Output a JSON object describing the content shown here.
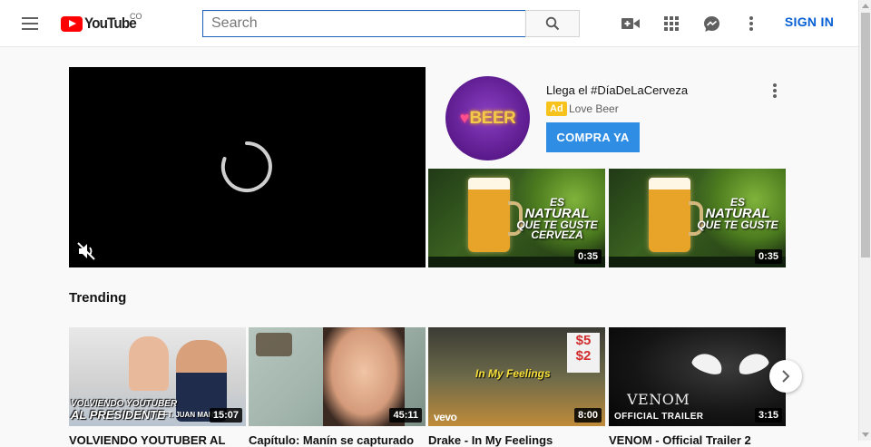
{
  "header": {
    "logo_text": "YouTube",
    "country_code": "CO",
    "search_placeholder": "Search",
    "sign_in_label": "SIGN IN"
  },
  "ad": {
    "title": "Llega el #DíaDeLaCerveza",
    "badge": "Ad",
    "channel": "Love Beer",
    "cta_label": "COMPRA YA",
    "avatar_brand": "BEER",
    "thumbnails": [
      {
        "line1": "ES",
        "line2": "NATURAL",
        "line3": "QUE TE GUSTE",
        "line4": "CERVEZA",
        "duration": "0:35"
      },
      {
        "line1": "ES",
        "line2": "NATURAL",
        "line3": "QUE TE GUSTE",
        "line4": "",
        "duration": "0:35"
      }
    ]
  },
  "trending": {
    "title": "Trending",
    "videos": [
      {
        "title": "VOLVIENDO YOUTUBER AL",
        "duration": "15:07",
        "caption_line1": "VOLVIENDO YOUTUBER",
        "caption_line2": "AL PRESIDENTE",
        "caption_extra": "FT. JUAN MANU"
      },
      {
        "title": "Capítulo: Manín se capturado",
        "duration": "45:11"
      },
      {
        "title": "Drake - In My Feelings",
        "duration": "8:00",
        "overlay": "In My Feelings",
        "sign_top": "$5",
        "sign_bottom": "$2",
        "brand": "vevo"
      },
      {
        "title": "VENOM - Official Trailer 2",
        "duration": "3:15",
        "overlay": "VENOM",
        "sub": "OFFICIAL TRAILER"
      }
    ]
  },
  "colors": {
    "brand_red": "#ff0000",
    "accent_blue": "#065fd4",
    "cta_blue": "#2f8de4",
    "ad_badge": "#f7c21c"
  }
}
